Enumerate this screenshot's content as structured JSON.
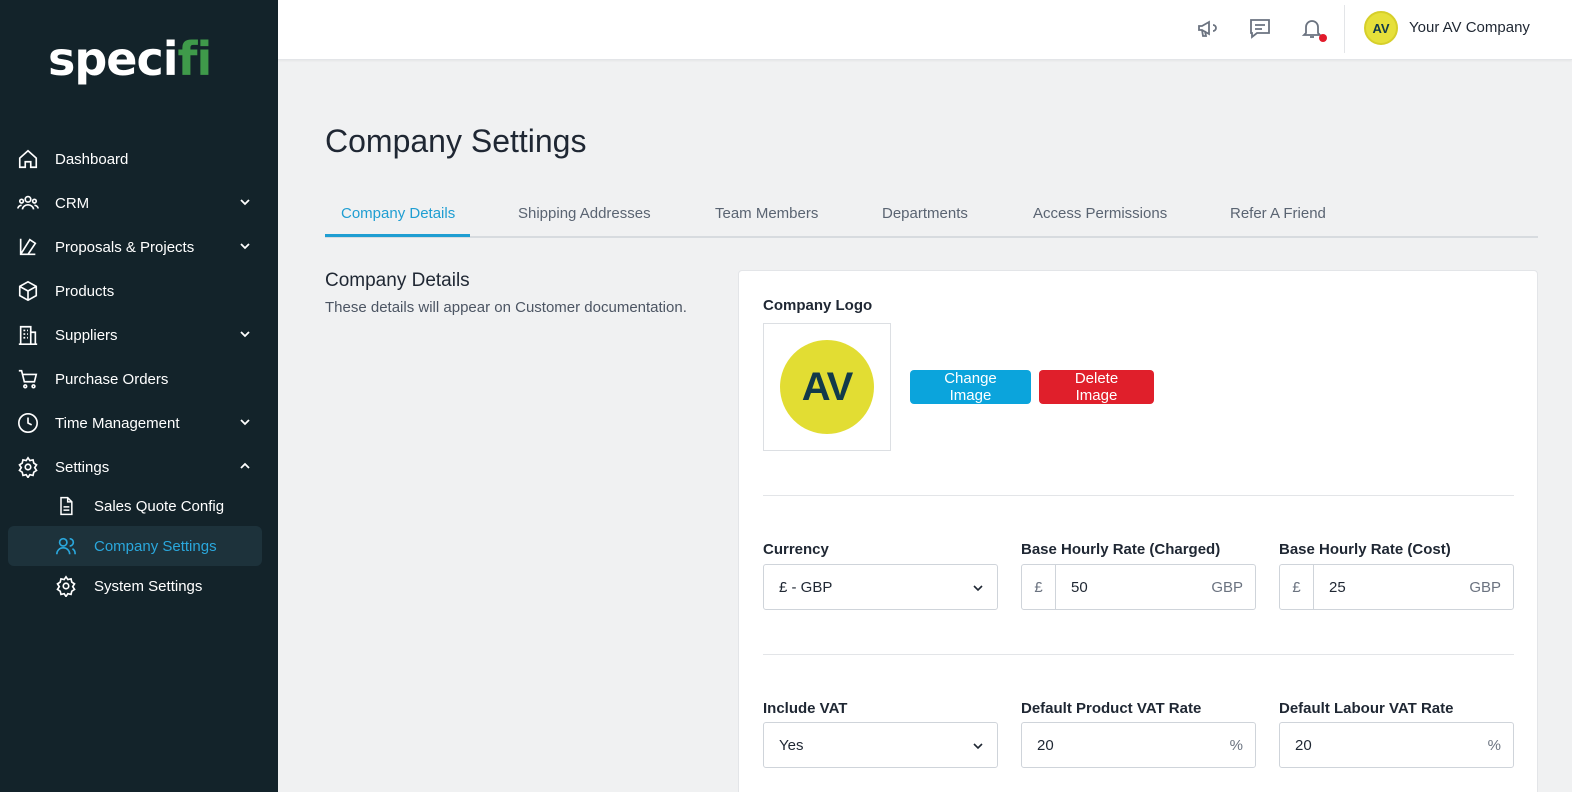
{
  "brand": {
    "logo_text_a": "speci",
    "logo_text_b": "fi"
  },
  "sidebar": {
    "items": [
      {
        "label": "Dashboard",
        "icon": "home-icon"
      },
      {
        "label": "CRM",
        "icon": "users-icon",
        "expandable": true
      },
      {
        "label": "Proposals & Projects",
        "icon": "proposals-icon",
        "expandable": true
      },
      {
        "label": "Products",
        "icon": "box-icon"
      },
      {
        "label": "Suppliers",
        "icon": "building-icon",
        "expandable": true
      },
      {
        "label": "Purchase Orders",
        "icon": "cart-icon"
      },
      {
        "label": "Time Management",
        "icon": "clock-icon",
        "expandable": true
      },
      {
        "label": "Settings",
        "icon": "gear-icon",
        "expanded": true
      }
    ],
    "sub_items": [
      {
        "label": "Sales Quote Config",
        "icon": "document-icon"
      },
      {
        "label": "Company Settings",
        "icon": "users-icon",
        "active": true
      },
      {
        "label": "System Settings",
        "icon": "gear-icon"
      }
    ]
  },
  "topbar": {
    "icons": [
      "megaphone-icon",
      "chat-icon",
      "bell-icon"
    ],
    "avatar_initials": "AV",
    "company_name": "Your AV Company"
  },
  "page": {
    "title": "Company Settings",
    "tabs": [
      {
        "label": "Company Details",
        "active": true
      },
      {
        "label": "Shipping Addresses"
      },
      {
        "label": "Team Members"
      },
      {
        "label": "Departments"
      },
      {
        "label": "Access Permissions"
      },
      {
        "label": "Refer A Friend"
      }
    ],
    "section": {
      "title": "Company Details",
      "description": "These details will appear on Customer documentation."
    }
  },
  "form": {
    "logo_label": "Company Logo",
    "logo_initials": "AV",
    "change_image": "Change Image",
    "delete_image": "Delete Image",
    "currency": {
      "label": "Currency",
      "value": "£ - GBP"
    },
    "rate_charged": {
      "label": "Base Hourly Rate (Charged)",
      "prefix": "£",
      "value": "50",
      "suffix": "GBP"
    },
    "rate_cost": {
      "label": "Base Hourly Rate (Cost)",
      "prefix": "£",
      "value": "25",
      "suffix": "GBP"
    },
    "include_vat": {
      "label": "Include VAT",
      "value": "Yes"
    },
    "product_vat": {
      "label": "Default Product VAT Rate",
      "value": "20",
      "suffix": "%"
    },
    "labour_vat": {
      "label": "Default Labour VAT Rate",
      "value": "20",
      "suffix": "%"
    }
  },
  "colors": {
    "sidebar_bg": "#13232a",
    "accent": "#1f9ed2",
    "danger": "#e01f2b",
    "brand_green": "#3f9a4a",
    "logo_yellow": "#e2dd33"
  }
}
